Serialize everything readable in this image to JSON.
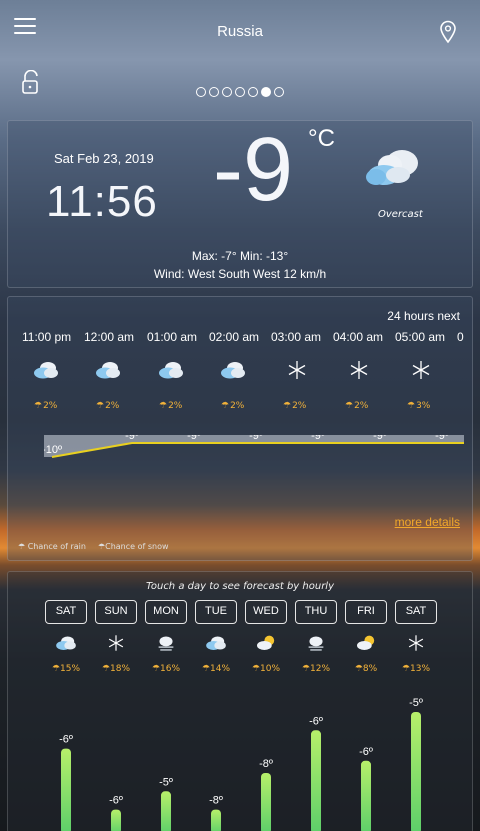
{
  "header": {
    "city": "Russia",
    "menu_icon": "hamburger-menu-icon",
    "location_icon": "map-pin-icon",
    "lock_icon": "unlock-icon"
  },
  "pager": {
    "count": 7,
    "active_index": 5
  },
  "current": {
    "date": "Sat Feb 23, 2019",
    "time": "11:56",
    "temperature": "-9",
    "unit": "°C",
    "condition": "Overcast",
    "condition_icon": "cloud-overcast-icon",
    "max_min": "Max: -7° Min: -13°",
    "wind": "Wind: West South West 12 km/h"
  },
  "hourly": {
    "header": "24 hours next",
    "items": [
      {
        "time": "11:00 pm",
        "icon": "partly-cloudy-icon",
        "chance": "2%",
        "temp_label": "-10º",
        "temp": -10
      },
      {
        "time": "12:00 am",
        "icon": "partly-cloudy-icon",
        "chance": "2%",
        "temp_label": "-9º",
        "temp": -9
      },
      {
        "time": "01:00 am",
        "icon": "partly-cloudy-icon",
        "chance": "2%",
        "temp_label": "-9º",
        "temp": -9
      },
      {
        "time": "02:00 am",
        "icon": "partly-cloudy-icon",
        "chance": "2%",
        "temp_label": "-9º",
        "temp": -9
      },
      {
        "time": "03:00 am",
        "icon": "snowflake-icon",
        "chance": "2%",
        "temp_label": "-9º",
        "temp": -9
      },
      {
        "time": "04:00 am",
        "icon": "snowflake-icon",
        "chance": "2%",
        "temp_label": "-9º",
        "temp": -9
      },
      {
        "time": "05:00 am",
        "icon": "snowflake-icon",
        "chance": "3%",
        "temp_label": "-9º",
        "temp": -9
      },
      {
        "time": "0",
        "icon": "",
        "chance": "",
        "temp_label": "",
        "temp": -9
      }
    ],
    "more_details": "more details",
    "legend": [
      "Chance of rain",
      "Chance of snow"
    ]
  },
  "daily": {
    "hint": "Touch a day to see forecast by hourly",
    "days": [
      {
        "day": "SAT",
        "icon": "partly-cloudy-icon",
        "chance": "15%",
        "high_label": "-6º",
        "high": -6
      },
      {
        "day": "SUN",
        "icon": "snowflake-icon",
        "chance": "18%",
        "high_label": "-6º",
        "high": -16
      },
      {
        "day": "MON",
        "icon": "cloud-fog-icon",
        "chance": "16%",
        "high_label": "-5º",
        "high": -13
      },
      {
        "day": "TUE",
        "icon": "partly-cloudy-icon",
        "chance": "14%",
        "high_label": "-8º",
        "high": -16
      },
      {
        "day": "WED",
        "icon": "partly-sunny-icon",
        "chance": "10%",
        "high_label": "-8º",
        "high": -10
      },
      {
        "day": "THU",
        "icon": "cloud-fog-icon",
        "chance": "12%",
        "high_label": "-6º",
        "high": -3
      },
      {
        "day": "FRI",
        "icon": "partly-sunny-icon",
        "chance": "8%",
        "high_label": "-6º",
        "high": -8
      },
      {
        "day": "SAT",
        "icon": "snowflake-icon",
        "chance": "13%",
        "high_label": "-5º",
        "high": 0
      }
    ]
  },
  "colors": {
    "accent": "#f2a82a",
    "temp_line": "#e8d020",
    "bar_top": "#b7ef6a",
    "bar_bottom": "#5ccf6a"
  }
}
